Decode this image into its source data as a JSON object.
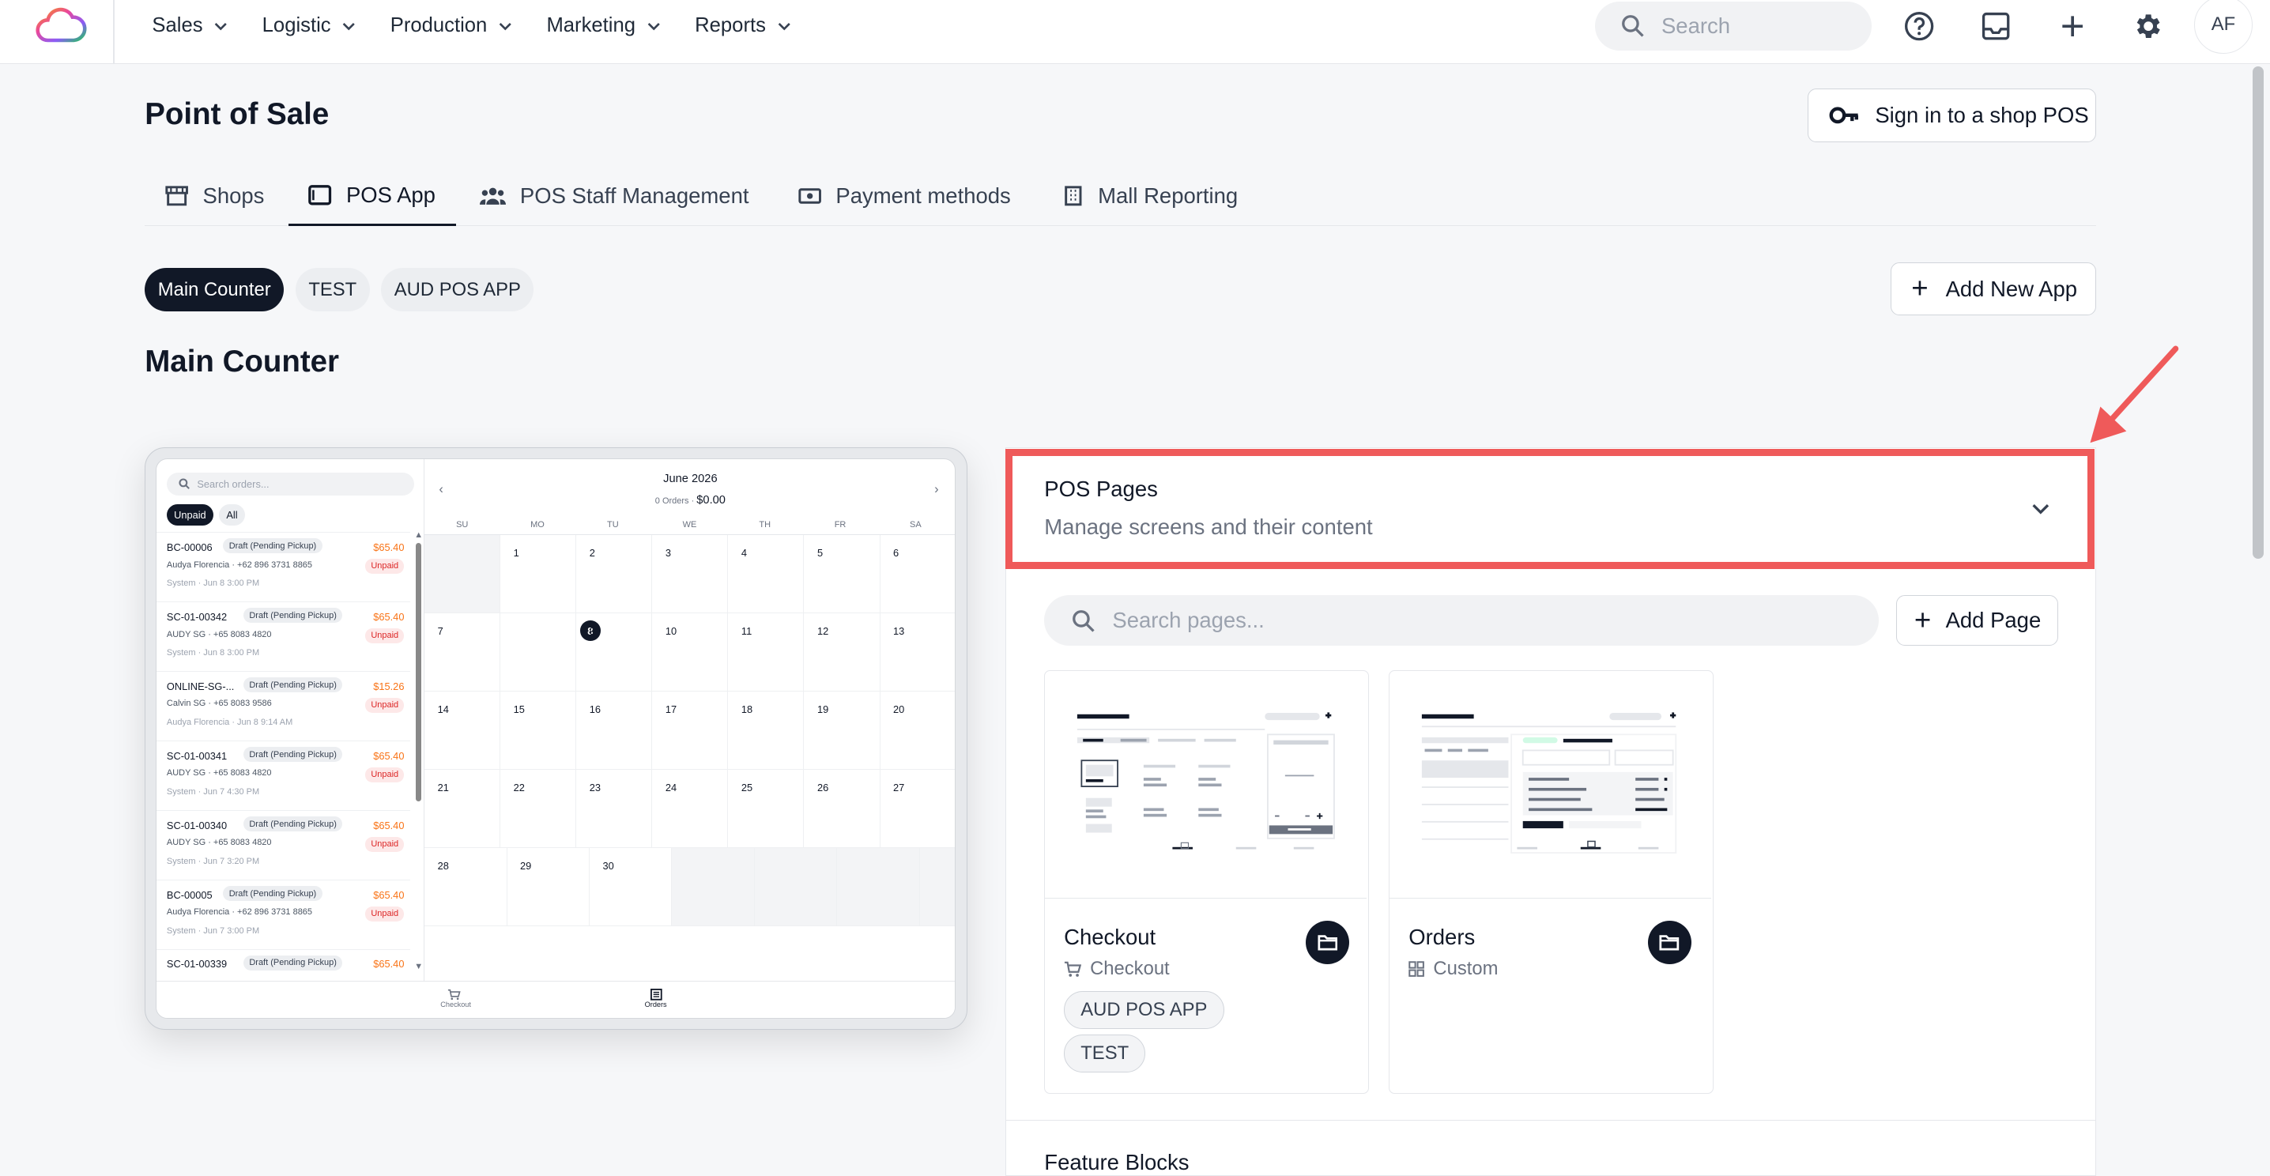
{
  "nav": {
    "items": [
      {
        "label": "Sales"
      },
      {
        "label": "Logistic"
      },
      {
        "label": "Production"
      },
      {
        "label": "Marketing"
      },
      {
        "label": "Reports"
      }
    ],
    "search_placeholder": "Search",
    "avatar_initials": "AF"
  },
  "header": {
    "title": "Point of Sale",
    "signin_label": "Sign in to a shop POS"
  },
  "tabs": [
    {
      "label": "Shops",
      "icon": "storefront-icon"
    },
    {
      "label": "POS App",
      "icon": "tablet-icon",
      "active": true
    },
    {
      "label": "POS Staff Management",
      "icon": "people-icon"
    },
    {
      "label": "Payment methods",
      "icon": "cash-icon"
    },
    {
      "label": "Mall Reporting",
      "icon": "building-icon"
    }
  ],
  "apps": {
    "pills": [
      {
        "label": "Main Counter",
        "active": true
      },
      {
        "label": "TEST"
      },
      {
        "label": "AUD POS APP"
      }
    ],
    "add_label": "Add New App",
    "section_title": "Main Counter"
  },
  "preview": {
    "search_placeholder": "Search orders...",
    "filters": [
      "Unpaid",
      "All"
    ],
    "orders": [
      {
        "id": "BC-00006",
        "status": "Draft (Pending Pickup)",
        "amount": "$65.40",
        "customer": "Audya Florencia · +62 896 3731 8865",
        "badge": "Unpaid",
        "time": "System · Jun 8 3:00 PM"
      },
      {
        "id": "SC-01-00342",
        "status": "Draft (Pending Pickup)",
        "amount": "$65.40",
        "customer": "AUDY SG · +65 8083 4820",
        "badge": "Unpaid",
        "time": "System · Jun 8 3:00 PM"
      },
      {
        "id": "ONLINE-SG-...",
        "status": "Draft (Pending Pickup)",
        "amount": "$15.26",
        "customer": "Calvin SG · +65 8083 9586",
        "badge": "Unpaid",
        "time": "Audya Florencia · Jun 8 9:14 AM"
      },
      {
        "id": "SC-01-00341",
        "status": "Draft (Pending Pickup)",
        "amount": "$65.40",
        "customer": "AUDY SG · +65 8083 4820",
        "badge": "Unpaid",
        "time": "System · Jun 7 4:30 PM"
      },
      {
        "id": "SC-01-00340",
        "status": "Draft (Pending Pickup)",
        "amount": "$65.40",
        "customer": "AUDY SG · +65 8083 4820",
        "badge": "Unpaid",
        "time": "System · Jun 7 3:20 PM"
      },
      {
        "id": "BC-00005",
        "status": "Draft (Pending Pickup)",
        "amount": "$65.40",
        "customer": "Audya Florencia · +62 896 3731 8865",
        "badge": "Unpaid",
        "time": "System · Jun 7 3:00 PM"
      },
      {
        "id": "SC-01-00339",
        "status": "Draft (Pending Pickup)",
        "amount": "$65.40",
        "customer": "",
        "badge": "",
        "time": ""
      }
    ],
    "calendar": {
      "month": "June 2026",
      "summary_prefix": "0 Orders · ",
      "summary_amount": "$0.00",
      "prev": "‹",
      "next": "›",
      "days": [
        "SU",
        "MO",
        "TU",
        "WE",
        "TH",
        "FR",
        "SA"
      ],
      "dates": [
        "",
        "1",
        "2",
        "3",
        "4",
        "5",
        "6",
        "7",
        "8",
        "9",
        "10",
        "11",
        "12",
        "13",
        "14",
        "15",
        "16",
        "17",
        "18",
        "19",
        "20",
        "21",
        "22",
        "23",
        "24",
        "25",
        "26",
        "27",
        "28",
        "29",
        "30",
        "",
        "",
        "",
        ""
      ],
      "today": "8"
    },
    "tabbar": [
      "Checkout",
      "Orders"
    ]
  },
  "pos_pages": {
    "title": "POS Pages",
    "subtitle": "Manage screens and their content",
    "search_placeholder": "Search pages...",
    "add_label": "Add Page",
    "cards": [
      {
        "name": "Checkout",
        "type": "Checkout",
        "type_icon": "cart-icon",
        "tags": [
          "AUD POS APP",
          "TEST"
        ]
      },
      {
        "name": "Orders",
        "type": "Custom",
        "type_icon": "grid-icon",
        "tags": []
      }
    ]
  },
  "feature_blocks": {
    "title": "Feature Blocks"
  },
  "colors": {
    "accent": "#111827",
    "highlight": "#ef5a5a",
    "amount": "#f97316",
    "unpaid": "#dc2626"
  }
}
